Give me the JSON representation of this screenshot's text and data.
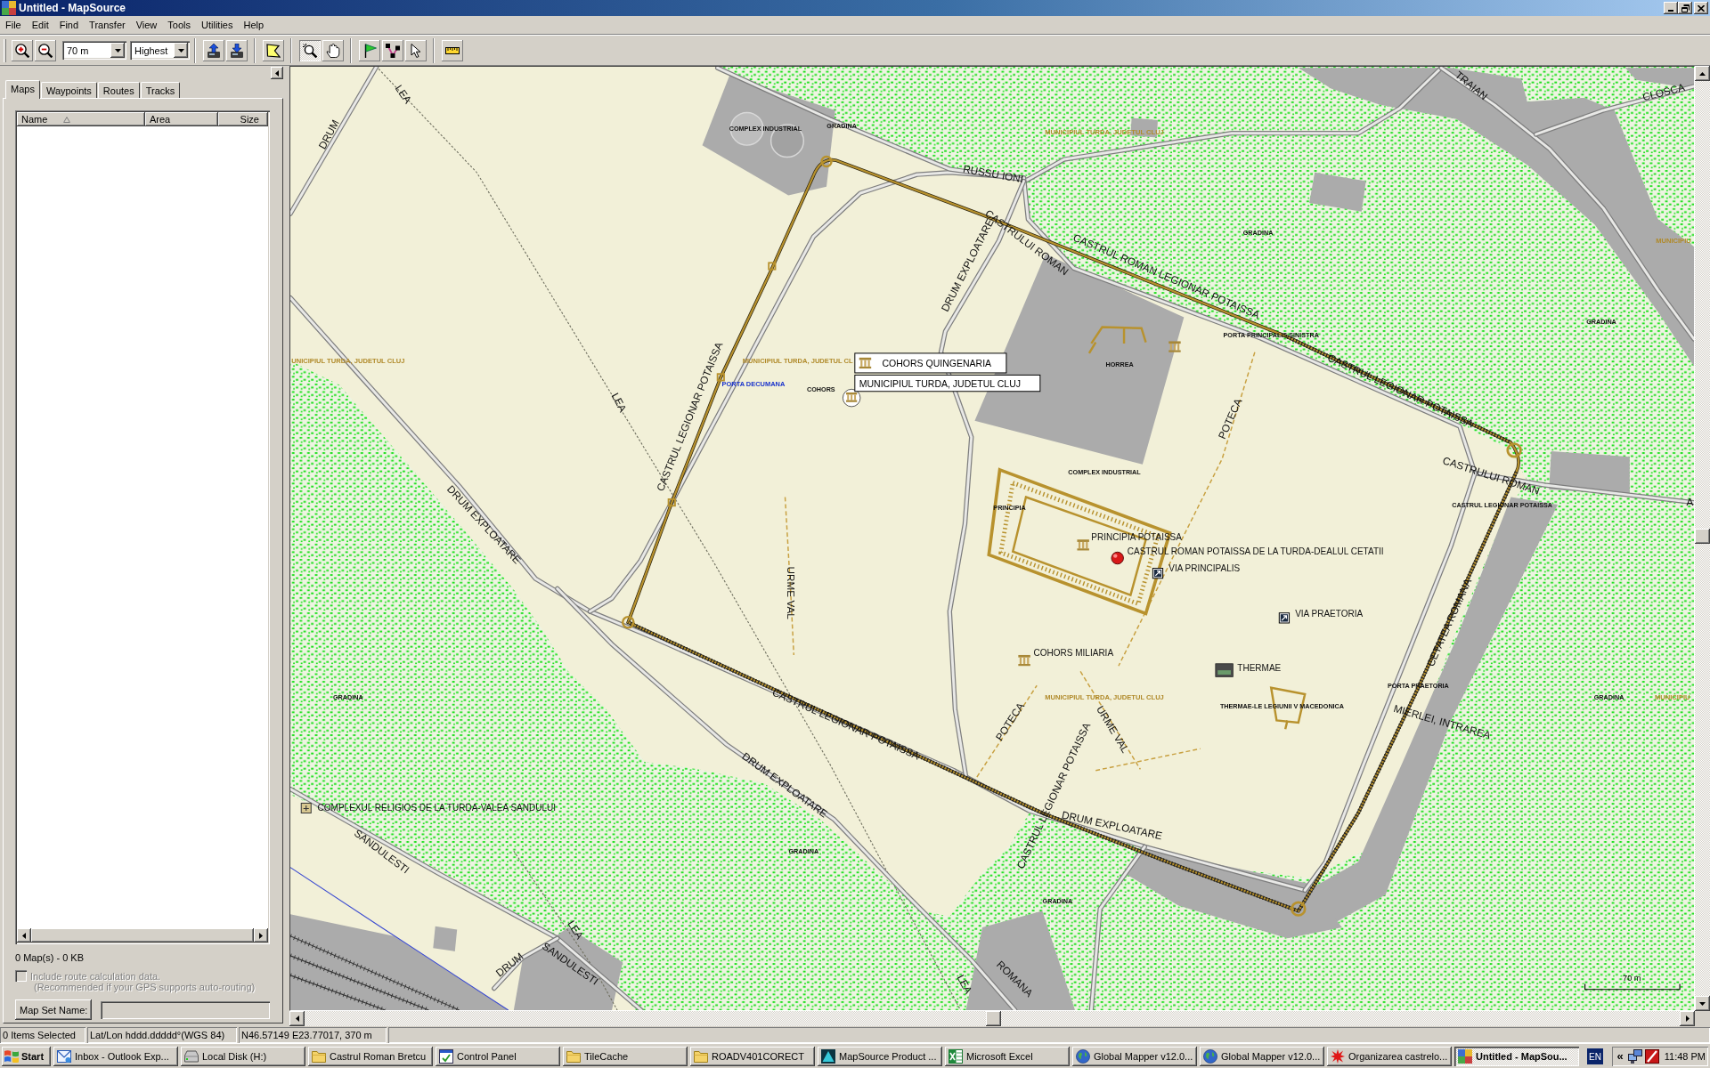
{
  "window": {
    "title": "Untitled - MapSource"
  },
  "menu": [
    "File",
    "Edit",
    "Find",
    "Transfer",
    "View",
    "Tools",
    "Utilities",
    "Help"
  ],
  "toolbar": {
    "zoom_buttons": [
      {
        "kind": "zoom-in"
      },
      {
        "kind": "zoom-out"
      }
    ],
    "scale": "70 m",
    "detail": "Highest",
    "transfer_buttons": [
      {
        "kind": "receive"
      },
      {
        "kind": "send"
      }
    ],
    "tools": [
      {
        "kind": "map",
        "selected": false
      },
      {
        "kind": "zoom",
        "selected": true
      },
      {
        "kind": "hand",
        "selected": false
      },
      {
        "kind": "waypoint",
        "selected": false
      },
      {
        "kind": "route",
        "selected": false
      },
      {
        "kind": "pointer",
        "selected": false
      },
      {
        "kind": "measure",
        "selected": false
      }
    ]
  },
  "sidebar": {
    "tabs": [
      {
        "label": "Maps",
        "selected": true
      },
      {
        "label": "Waypoints",
        "selected": false
      },
      {
        "label": "Routes",
        "selected": false
      },
      {
        "label": "Tracks",
        "selected": false
      }
    ],
    "columns": [
      "Name",
      "Area",
      "Size"
    ],
    "summary": "0 Map(s) - 0 KB",
    "route_option": {
      "label": "Include route calculation data.",
      "note": "(Recommended if your GPS supports auto-routing)",
      "checked": false,
      "disabled": true
    },
    "map_set_name": {
      "label": "Map Set Name:"
    },
    "map_set_field": {
      "disabled": true
    }
  },
  "map": {
    "labels": [
      {
        "text": "LEA",
        "kind": "street"
      },
      {
        "text": "COMPLEX INDUSTRIAL",
        "kind": "place"
      },
      {
        "text": "GRADINA",
        "kind": "place"
      },
      {
        "text": "MUNICIPIUL TURDA, JUDETUL CLUJ",
        "kind": "boundary"
      },
      {
        "text": "TRAIAN",
        "kind": "street"
      },
      {
        "text": "CLOSCA",
        "kind": "street"
      },
      {
        "text": "DRUM",
        "kind": "street"
      },
      {
        "text": "RUSSU IONI",
        "kind": "street"
      },
      {
        "text": "GRADINA",
        "kind": "place"
      },
      {
        "text": "MUNICIPIU",
        "kind": "boundary"
      },
      {
        "text": "CASTRULUI ROMAN",
        "kind": "street"
      },
      {
        "text": "DRUM EXPLOATARE",
        "kind": "street"
      },
      {
        "text": "CASTRUL ROMAN LEGIONAR POTAISSA",
        "kind": "street"
      },
      {
        "text": "GRADINA",
        "kind": "place"
      },
      {
        "text": "PORTA PRINCIPALIS SINISTRA",
        "kind": "place"
      },
      {
        "text": "HORREA",
        "kind": "place"
      },
      {
        "text": "UNICIPIUL TURDA, JUDETUL CLUJ",
        "kind": "boundary"
      },
      {
        "text": "MUNICIPIUL TURDA, JUDETUL CL",
        "kind": "boundary"
      },
      {
        "text": "PORTA DECUMANA",
        "kind": "highlight"
      },
      {
        "text": "COHORS",
        "kind": "place"
      },
      {
        "text": "CASTRUL LEGIONAR POTAISSA",
        "kind": "street"
      },
      {
        "text": "LEA",
        "kind": "street"
      },
      {
        "text": "CASTRUL LEGIONAR POTAISSA",
        "kind": "street"
      },
      {
        "text": "POTECA",
        "kind": "street"
      },
      {
        "text": "COMPLEX INDUSTRIAL",
        "kind": "place"
      },
      {
        "text": "CASTRULUI ROMAN",
        "kind": "street"
      },
      {
        "text": "CASTRUL LEGIONAR POTAISSA",
        "kind": "place"
      },
      {
        "text": "A",
        "kind": "street"
      },
      {
        "text": "PRINCIPIA",
        "kind": "place"
      },
      {
        "text": "DRUM EXPLOATARE",
        "kind": "street"
      },
      {
        "text": "PRINCIPIA POTAISSA",
        "kind": "poi"
      },
      {
        "text": "CASTRUL ROMAN POTAISSA DE LA TURDA-DEALUL CETATII",
        "kind": "poi"
      },
      {
        "text": "VIA PRINCIPALIS",
        "kind": "poi"
      },
      {
        "text": "URME VAL",
        "kind": "street"
      },
      {
        "text": "VIA PRAETORIA",
        "kind": "poi"
      },
      {
        "text": "CETATEA ROMANA",
        "kind": "street"
      },
      {
        "text": "COHORS MILIARIA",
        "kind": "poi"
      },
      {
        "text": "THERMAE",
        "kind": "poi"
      },
      {
        "text": "PORTA PRAETORIA",
        "kind": "place"
      },
      {
        "text": "GRADINA",
        "kind": "place"
      },
      {
        "text": "MUNICIPIUL TURDA, JUDETUL CLUJ",
        "kind": "boundary"
      },
      {
        "text": "GRADINA",
        "kind": "place"
      },
      {
        "text": "MUNICIPIU",
        "kind": "boundary"
      },
      {
        "text": "THERMAE-LE LEGIUNII V MACEDONICA",
        "kind": "place"
      },
      {
        "text": "CASTRUL LEGIONAR POTAISSA",
        "kind": "street"
      },
      {
        "text": "POTECA",
        "kind": "street"
      },
      {
        "text": "MIERLEI, INTRAREA",
        "kind": "street"
      },
      {
        "text": "URME VAL",
        "kind": "street"
      },
      {
        "text": "DRUM EXPLOATARE",
        "kind": "street"
      },
      {
        "text": "CASTRUL LEGIONAR POTAISSA",
        "kind": "street"
      },
      {
        "text": "COMPLEXUL RELIGIOS DE LA TURDA-VALEA SANDULUI",
        "kind": "poi"
      },
      {
        "text": "DRUM EXPLOATARE",
        "kind": "street"
      },
      {
        "text": "GRADINA",
        "kind": "place"
      },
      {
        "text": "SANDULESTI",
        "kind": "street"
      },
      {
        "text": "GRADINA",
        "kind": "place"
      },
      {
        "text": "LEA",
        "kind": "street"
      },
      {
        "text": "DRUM",
        "kind": "street"
      },
      {
        "text": "SANDULESTI",
        "kind": "street"
      },
      {
        "text": "LEA",
        "kind": "street"
      },
      {
        "text": "ROMANA",
        "kind": "street"
      }
    ],
    "tooltips": [
      "COHORS QUINGENARIA",
      "MUNICIPIUL TURDA, JUDETUL CLUJ"
    ],
    "scale": "70 m"
  },
  "status_bar": [
    "0 Items Selected",
    "Lat/Lon hddd.ddddd°(WGS 84)",
    "N46.57149 E23.77017, 370 m"
  ],
  "taskbar": {
    "start": "Start",
    "tasks": [
      {
        "label": "Inbox - Outlook Exp...",
        "selected": false
      },
      {
        "label": "Local Disk (H:)",
        "selected": false
      },
      {
        "label": "Castrul Roman Bretcu",
        "selected": false
      },
      {
        "label": "Control Panel",
        "selected": false
      },
      {
        "label": "TileCache",
        "selected": false
      },
      {
        "label": "ROADV401CORECT",
        "selected": false
      },
      {
        "label": "MapSource Product ...",
        "selected": false
      },
      {
        "label": "Microsoft Excel",
        "selected": false
      },
      {
        "label": "Global Mapper v12.0...",
        "selected": false
      },
      {
        "label": "Global Mapper v12.0...",
        "selected": false
      },
      {
        "label": "Organizarea castrelo...",
        "selected": false
      },
      {
        "label": "Untitled - MapSou...",
        "selected": true
      }
    ],
    "language": "EN",
    "tray_toggle": "«",
    "clock": "11:48 PM"
  }
}
